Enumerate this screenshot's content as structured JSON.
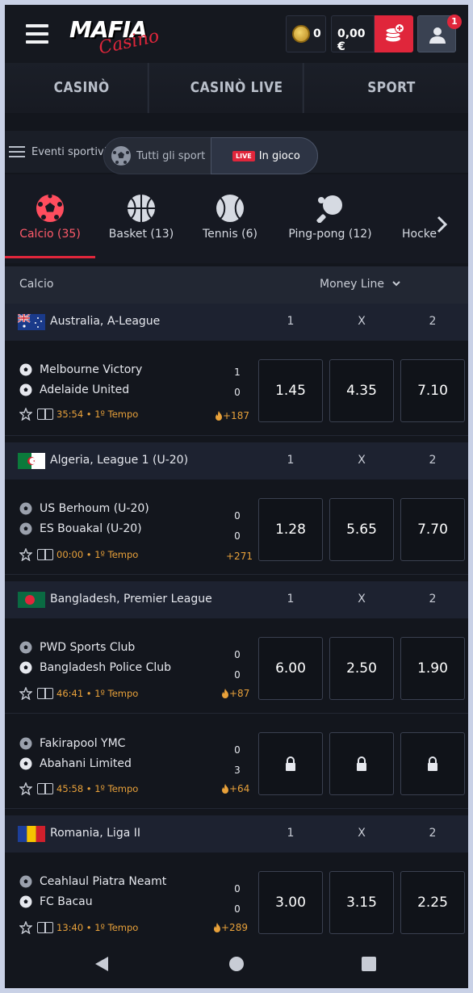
{
  "header": {
    "logo_main": "MAFIA",
    "logo_sub": "Casino",
    "coins": "0",
    "balance": "0,00 €",
    "notifications": "1",
    "icons": {
      "menu": "hamburger-icon",
      "coin": "coin-icon",
      "deposit": "coins-plus-icon",
      "user": "user-icon"
    },
    "colors": {
      "accent": "#e0263b",
      "background": "#13161d"
    }
  },
  "main_nav": [
    "CASINÒ",
    "CASINÒ LIVE",
    "SPORT"
  ],
  "filter": {
    "events_label": "Eventi sportivi",
    "all_sports_label": "Tutti gli sport",
    "live_chip": "LIVE",
    "live_label": "In gioco"
  },
  "sport_tabs": [
    {
      "label": "Calcio (35)",
      "icon": "soccer-ball-icon",
      "active": true
    },
    {
      "label": "Basket (13)",
      "icon": "basketball-icon",
      "active": false
    },
    {
      "label": "Tennis (6)",
      "icon": "tennis-ball-icon",
      "active": false
    },
    {
      "label": "Ping-pong (12)",
      "icon": "ping-pong-icon",
      "active": false
    },
    {
      "label": "Hocke",
      "icon": "hockey-icon",
      "active": false
    }
  ],
  "market": {
    "sport": "Calcio",
    "type": "Money Line"
  },
  "columns": [
    "1",
    "X",
    "2"
  ],
  "leagues": [
    {
      "name": "Australia, A-League",
      "flag": "australia",
      "events": [
        {
          "home": "Melbourne Victory",
          "away": "Adelaide United",
          "home_score": "1",
          "away_score": "0",
          "time": "35:54 • 1º Tempo",
          "more": "+187",
          "hot": true,
          "odds": [
            "1.45",
            "4.35",
            "7.10"
          ]
        }
      ]
    },
    {
      "name": "Algeria, League 1 (U-20)",
      "flag": "algeria",
      "events": [
        {
          "home": "US Berhoum (U-20)",
          "away": "ES Bouakal (U-20)",
          "home_score": "0",
          "away_score": "0",
          "time": "00:00 • 1º Tempo",
          "more": "+271",
          "hot": false,
          "odds": [
            "1.28",
            "5.65",
            "7.70"
          ]
        }
      ]
    },
    {
      "name": "Bangladesh, Premier League",
      "flag": "bangladesh",
      "events": [
        {
          "home": "PWD Sports Club",
          "away": "Bangladesh Police Club",
          "home_score": "0",
          "away_score": "0",
          "time": "46:41 • 1º Tempo",
          "more": "+87",
          "hot": true,
          "odds": [
            "6.00",
            "2.50",
            "1.90"
          ]
        },
        {
          "home": "Fakirapool YMC",
          "away": "Abahani Limited",
          "home_score": "0",
          "away_score": "3",
          "time": "45:58 • 1º Tempo",
          "more": "+64",
          "hot": true,
          "odds": [
            "locked",
            "locked",
            "locked"
          ]
        }
      ]
    },
    {
      "name": "Romania, Liga II",
      "flag": "romania",
      "events": [
        {
          "home": "Ceahlaul Piatra Neamt",
          "away": "FC Bacau",
          "home_score": "0",
          "away_score": "0",
          "time": "13:40 • 1º Tempo",
          "more": "+289",
          "hot": true,
          "odds": [
            "3.00",
            "3.15",
            "2.25"
          ]
        }
      ]
    }
  ],
  "system_nav": {
    "back": "back-icon",
    "home": "home-icon",
    "recents": "recents-icon"
  }
}
